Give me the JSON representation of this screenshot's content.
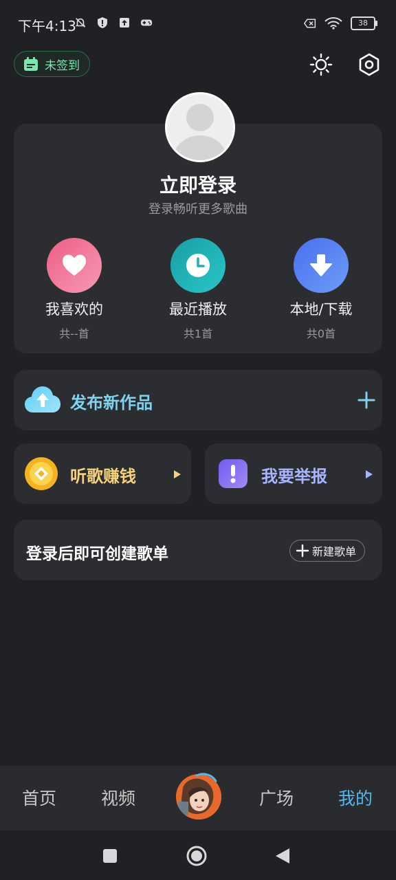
{
  "status_bar": {
    "time": "下午4:13",
    "battery": "38"
  },
  "header": {
    "checkin_label": "未签到"
  },
  "profile": {
    "title": "立即登录",
    "subtitle": "登录畅听更多歌曲",
    "quick_actions": [
      {
        "label": "我喜欢的",
        "count": "共--首",
        "icon": "heart-icon",
        "color": "#f06a8e"
      },
      {
        "label": "最近播放",
        "count": "共1首",
        "icon": "clock-icon",
        "color": "#1fb3b8"
      },
      {
        "label": "本地/下载",
        "count": "共0首",
        "icon": "download-icon",
        "color": "#5b82f0"
      }
    ]
  },
  "publish": {
    "label": "发布新作品"
  },
  "earn": {
    "label": "听歌赚钱"
  },
  "report": {
    "label": "我要举报"
  },
  "playlist": {
    "text": "登录后即可创建歌单",
    "new_button": "新建歌单"
  },
  "bottom_nav": {
    "home": "首页",
    "video": "视频",
    "square": "广场",
    "mine": "我的"
  },
  "colors": {
    "accent": "#4fb8f0",
    "background": "#202124",
    "card": "#2c2d30"
  }
}
